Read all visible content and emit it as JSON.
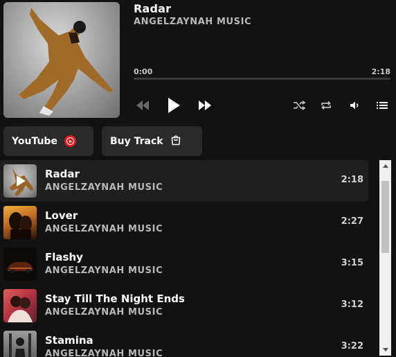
{
  "now_playing": {
    "title": "Radar",
    "artist": "ANGELZAYNAH MUSIC",
    "current_time": "0:00",
    "duration": "2:18",
    "progress_fraction": 0
  },
  "controls": {
    "rewind_icon": "rewind-icon",
    "play_icon": "play-icon",
    "forward_icon": "fast-forward-icon",
    "shuffle_icon": "shuffle-icon",
    "repeat_icon": "repeat-icon",
    "volume_icon": "volume-icon",
    "playlist_icon": "playlist-icon"
  },
  "buttons": {
    "youtube_label": "YouTube",
    "buy_label": "Buy Track"
  },
  "colors": {
    "background": "#121212",
    "youtube_red": "#e01a1a",
    "button_bg": "#2a2a2a"
  },
  "tracks": [
    {
      "title": "Radar",
      "artist": "ANGELZAYNAH MUSIC",
      "duration": "2:18",
      "active": true
    },
    {
      "title": "Lover",
      "artist": "ANGELZAYNAH MUSIC",
      "duration": "2:27",
      "active": false
    },
    {
      "title": "Flashy",
      "artist": "ANGELZAYNAH MUSIC",
      "duration": "3:15",
      "active": false
    },
    {
      "title": "Stay Till The Night Ends",
      "artist": "ANGELZAYNAH MUSIC",
      "duration": "3:12",
      "active": false
    },
    {
      "title": "Stamina",
      "artist": "ANGELZAYNAH MUSIC",
      "duration": "3:22",
      "active": false
    }
  ]
}
